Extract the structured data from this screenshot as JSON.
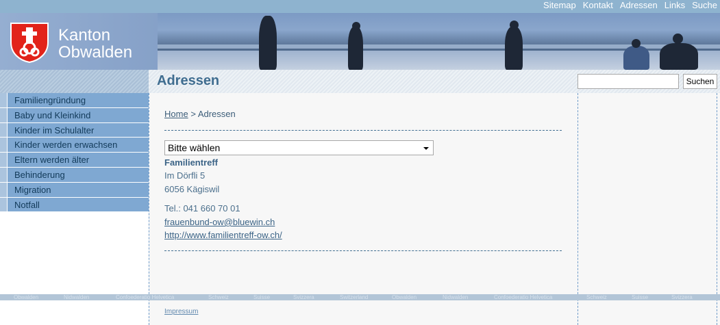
{
  "topnav": [
    "Sitemap",
    "Kontakt",
    "Adressen",
    "Links",
    "Suche"
  ],
  "brand": {
    "line1": "Kanton",
    "line2": "Obwalden"
  },
  "page_title": "Adressen",
  "search": {
    "button": "Suchen",
    "value": ""
  },
  "sidebar": {
    "items": [
      {
        "label": "Familiengründung"
      },
      {
        "label": "Baby und Kleinkind"
      },
      {
        "label": "Kinder im Schulalter"
      },
      {
        "label": "Kinder werden erwachsen"
      },
      {
        "label": "Eltern werden älter"
      },
      {
        "label": "Behinderung"
      },
      {
        "label": "Migration"
      },
      {
        "label": "Notfall"
      }
    ]
  },
  "breadcrumb": {
    "home": "Home",
    "separator": ">",
    "current": "Adressen"
  },
  "select": {
    "value": "Bitte wählen"
  },
  "address": {
    "name": "Familientreff",
    "street": "Im Dörfli 5",
    "city": "6056 Kägiswil",
    "phone": "Tel.: 041 660 70 01",
    "email": "frauenbund-ow@bluewin.ch",
    "website": "http://www.familientreff-ow.ch/"
  },
  "footer_stripe": [
    "Obwalden",
    "Nidwalden",
    "Confoederatio Helvetica",
    "Schweiz",
    "Suisse",
    "Svizzera",
    "Switzerland",
    "Obwalden",
    "Nidwalden",
    "Confoederatio Helvetica",
    "Schweiz",
    "Suisse",
    "Svizzera"
  ],
  "impressum": "Impressum",
  "colors": {
    "accent": "#3f6d90",
    "nav_bg": "#7fa8d2",
    "topbar": "#8eb3cf"
  }
}
